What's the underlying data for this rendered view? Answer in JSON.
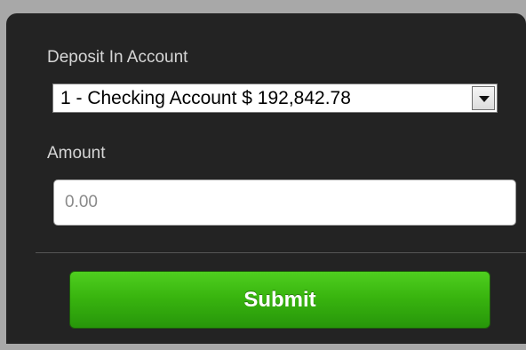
{
  "form": {
    "deposit_label": "Deposit In Account",
    "account_select": {
      "selected": "1 - Checking Account $ 192,842.78"
    },
    "amount_label": "Amount",
    "amount_input": {
      "value": "",
      "placeholder": "0.00"
    },
    "submit_label": "Submit"
  },
  "colors": {
    "panel_background": "#232323",
    "outer_background": "#a8a8a8",
    "submit_green": "#39b50f",
    "label_text": "#d6d6d6"
  }
}
